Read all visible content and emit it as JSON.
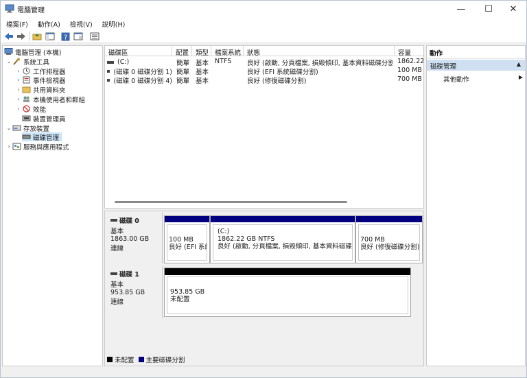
{
  "window": {
    "title": "電腦管理",
    "minimize": "—",
    "maximize": "☐",
    "close": "✕"
  },
  "menu": [
    "檔案(F)",
    "動作(A)",
    "檢視(V)",
    "說明(H)"
  ],
  "tree": {
    "root": "電腦管理 (本機)",
    "system_tools": "系統工具",
    "task_scheduler": "工作排程器",
    "event_viewer": "事件檢視器",
    "shared_folders": "共用資料夾",
    "local_users": "本機使用者和群組",
    "performance": "效能",
    "device_manager": "裝置管理員",
    "storage": "存放裝置",
    "disk_management": "磁碟管理",
    "services_apps": "服務與應用程式"
  },
  "volumes": {
    "headers": [
      "磁碟區",
      "配置",
      "類型",
      "檔案系統",
      "狀態",
      "容量"
    ],
    "rows": [
      [
        "(C:)",
        "簡單",
        "基本",
        "NTFS",
        "良好 (啟動, 分頁檔案, 損毀傾印, 基本資料磁碟分割)",
        "1862.22"
      ],
      [
        "(磁碟 0 磁碟分割 1)",
        "簡單",
        "基本",
        "",
        "良好 (EFI 系統磁碟分割)",
        "100 MB"
      ],
      [
        "(磁碟 0 磁碟分割 4)",
        "簡單",
        "基本",
        "",
        "良好 (修復磁碟分割)",
        "700 MB"
      ]
    ]
  },
  "disks": {
    "disk0": {
      "name": "磁碟 0",
      "type": "基本",
      "size": "1863.00 GB",
      "status": "連線",
      "p1_size": "100 MB",
      "p1_status": "良好 (EFI 系統",
      "p2_name": "(C:)",
      "p2_size": "1862.22 GB NTFS",
      "p2_status": "良好 (啟動, 分頁檔案, 損毀傾印, 基本資料磁碟分",
      "p3_size": "700 MB",
      "p3_status": "良好 (修復磁碟分割)"
    },
    "disk1": {
      "name": "磁碟 1",
      "type": "基本",
      "size": "953.85 GB",
      "status": "連線",
      "p1_size": "953.85 GB",
      "p1_status": "未配置"
    }
  },
  "legend": {
    "unallocated": "未配置",
    "primary": "主要磁碟分割",
    "unallocated_color": "#000000",
    "primary_color": "#000080"
  },
  "actions": {
    "title": "動作",
    "section": "磁碟管理",
    "more": "其他動作"
  }
}
